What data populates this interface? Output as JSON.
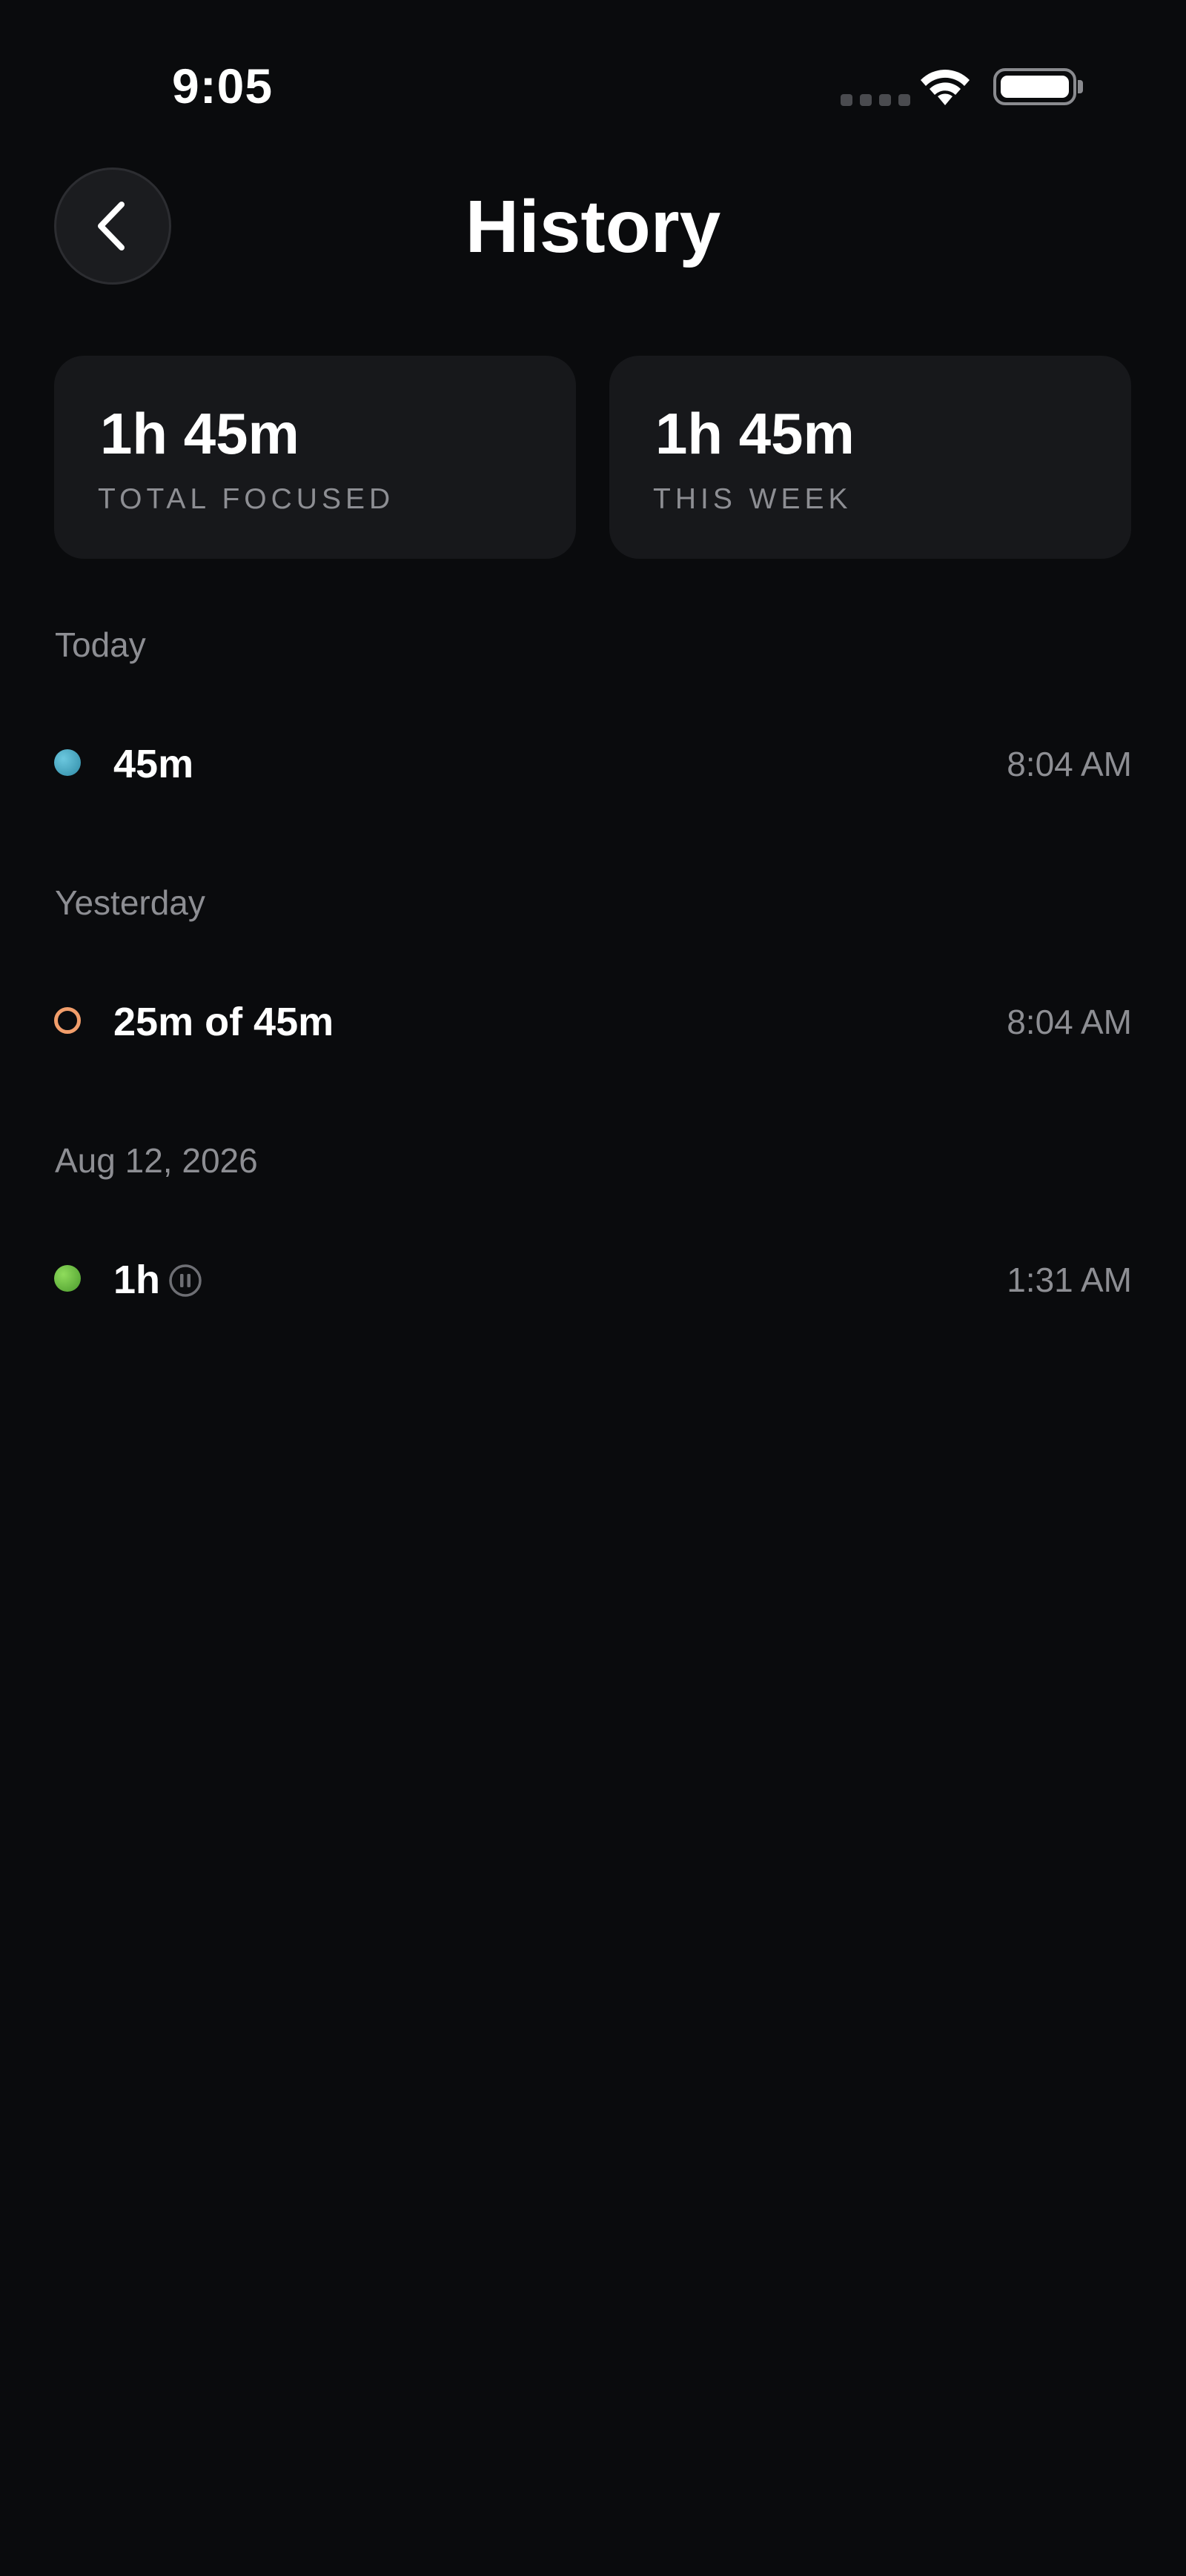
{
  "status_bar": {
    "time": "9:05"
  },
  "header": {
    "title": "History",
    "back_icon": "chevron-left-icon"
  },
  "stats": [
    {
      "value": "1h 45m",
      "label": "TOTAL FOCUSED"
    },
    {
      "value": "1h 45m",
      "label": "THIS WEEK"
    }
  ],
  "sections": [
    {
      "heading": "Today",
      "sessions": [
        {
          "duration": "45m",
          "time": "8:04 AM",
          "status": "completed",
          "color": "#3fa4c0"
        }
      ]
    },
    {
      "heading": "Yesterday",
      "sessions": [
        {
          "duration": "25m of 45m",
          "time": "8:04 AM",
          "status": "incomplete",
          "color": "#f29e6b"
        }
      ]
    },
    {
      "heading": "Aug 12, 2026",
      "sessions": [
        {
          "duration": "1h",
          "time": "1:31 AM",
          "status": "completed-paused",
          "color": "#6cc23f",
          "icon": "pause-circle-icon"
        }
      ]
    }
  ],
  "colors": {
    "background": "#0a0b0d",
    "card": "#17181b",
    "muted_text": "#8d8e93"
  }
}
